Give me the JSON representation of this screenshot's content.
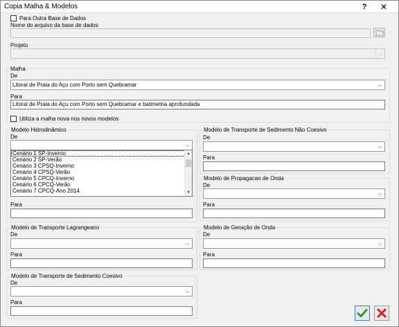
{
  "window": {
    "title": "Copia Malha & Modelos",
    "help_label": "?",
    "close_label": "✕"
  },
  "database": {
    "other_db_label": "Para Outra Base de Dados",
    "other_db_checked": false,
    "file_label": "Nome do arquivo da base de dados",
    "file_value": "",
    "project_label": "Projeto",
    "project_value": ""
  },
  "mesh": {
    "group_title": "Malha",
    "from_label": "De",
    "from_value": "Litoral de Praia do Açu com Porto sem Quebramar",
    "to_label": "Para",
    "to_value": "Litoral de Praia do Açu com Porto sem Quebramar e batimetria aprofundada",
    "use_new_label": "Utiliza a malha nova nos novos modelos",
    "use_new_checked": false
  },
  "hydro": {
    "group_title": "Modelo Hidrodinâmico",
    "from_label": "De",
    "from_value": "",
    "options": [
      "Cenário 1 SP-Inverno",
      "Cenário 2 SP-Verão",
      "Cenário 3 CPSQ-Inverno",
      "Cenário 4 CPSQ-Verão",
      "Cenário 5 CPCQ-Inverno",
      "Cenário 6 CPCQ-Verão",
      "Cenário 7 CPCQ-Ano 2014"
    ],
    "to_label": "Para",
    "to_value": ""
  },
  "non_cohesive": {
    "group_title": "Modelo de Transporte de Sedimento Não Coesivo",
    "from_label": "De",
    "from_value": "",
    "to_label": "Para",
    "to_value": ""
  },
  "wave": {
    "group_title": "Modelo de Propagacao de Onda",
    "from_label": "De",
    "from_value": "",
    "to_label": "Para",
    "to_value": ""
  },
  "lagrangian": {
    "group_title": "Modelo de Transporte Lagrangeano",
    "from_label": "De",
    "from_value": "",
    "to_label": "Para",
    "to_value": ""
  },
  "wave_gen": {
    "group_title": "Modelo de Geração de Onda",
    "from_label": "De",
    "from_value": "",
    "to_label": "Para",
    "to_value": ""
  },
  "cohesive": {
    "group_title": "Modelo de Transporte de Sedimento Coesivo",
    "from_label": "De",
    "from_value": "",
    "to_label": "Para",
    "to_value": ""
  },
  "icons": {
    "browse": "folder-icon",
    "ok": "green-check-icon",
    "cancel": "red-x-icon",
    "dropdown": "chevron-down-icon"
  },
  "colors": {
    "ok_green": "#2e9a2e",
    "cancel_red": "#d42020"
  }
}
